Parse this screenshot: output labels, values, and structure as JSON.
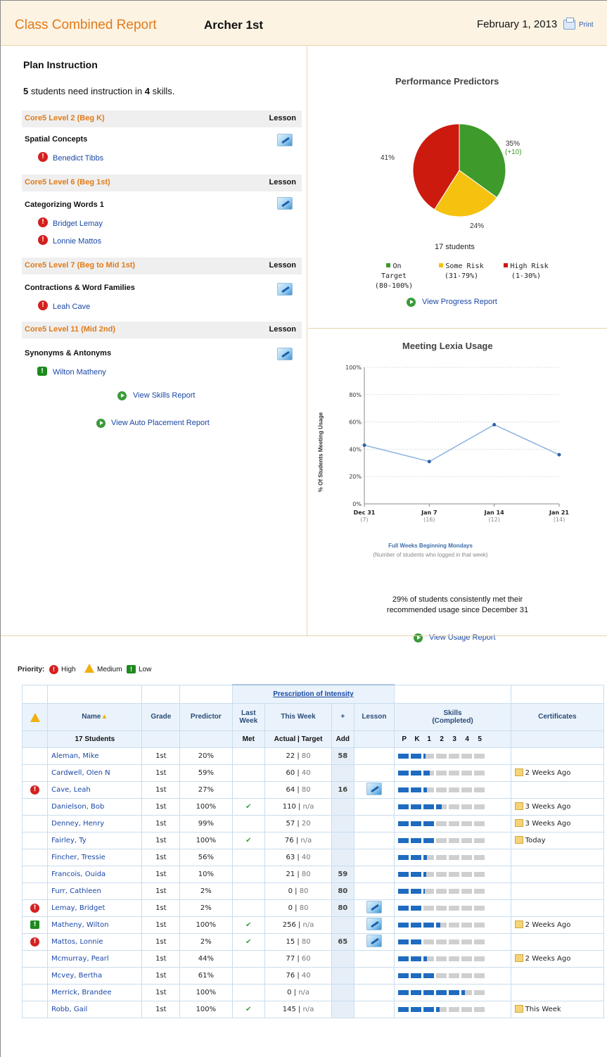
{
  "header": {
    "title": "Class Combined Report",
    "class_name": "Archer 1st",
    "date": "February 1, 2013",
    "print_label": "Print"
  },
  "plan": {
    "title": "Plan Instruction",
    "students_count": "5",
    "text_mid": "students need instruction in",
    "skills_count": "4",
    "text_end": "skills.",
    "lesson_label": "Lesson",
    "levels": [
      {
        "level": "Core5 Level 2 (Beg K)",
        "skill": "Spatial Concepts",
        "students": [
          {
            "name": "Benedict Tibbs",
            "priority": "high"
          }
        ]
      },
      {
        "level": "Core5 Level 6 (Beg 1st)",
        "skill": "Categorizing Words 1",
        "students": [
          {
            "name": "Bridget Lemay",
            "priority": "high"
          },
          {
            "name": "Lonnie Mattos",
            "priority": "high"
          }
        ]
      },
      {
        "level": "Core5 Level 7 (Beg to Mid 1st)",
        "skill": "Contractions & Word Families",
        "students": [
          {
            "name": "Leah Cave",
            "priority": "high"
          }
        ]
      },
      {
        "level": "Core5 Level 11 (Mid 2nd)",
        "skill": "Synonyms & Antonyms",
        "students": [
          {
            "name": "Wilton Matheny",
            "priority": "low"
          }
        ]
      }
    ],
    "links": {
      "skills": "View Skills Report",
      "placement": "View Auto Placement Report"
    }
  },
  "predictors": {
    "title": "Performance Predictors",
    "students_label": "17 students",
    "link": "View Progress Report",
    "slice_labels": {
      "on_target": "35%",
      "on_target_change": "(+10)",
      "some_risk": "24%",
      "high_risk": "41%"
    },
    "legend": [
      {
        "name": "On Target",
        "range": "(80-100%)",
        "color": "#3f9a2c"
      },
      {
        "name": "Some Risk",
        "range": "(31-79%)",
        "color": "#f5c20f"
      },
      {
        "name": "High Risk",
        "range": "(1-30%)",
        "color": "#cc1a0f"
      }
    ]
  },
  "usage": {
    "title": "Meeting Lexia Usage",
    "ylabel": "% Of Students Meeting Usage",
    "xlabel": "Full Weeks Beginning Mondays",
    "xsub": "(Number of students who logged in that week)",
    "summary_line1": "29% of students consistently met their",
    "summary_line2": "recommended usage since December 31",
    "link": "View Usage Report"
  },
  "chart_data": [
    {
      "type": "pie",
      "title": "Performance Predictors",
      "categories": [
        "On Target",
        "Some Risk",
        "High Risk"
      ],
      "values": [
        35,
        24,
        41
      ],
      "colors": [
        "#3f9a2c",
        "#f5c20f",
        "#cc1a0f"
      ]
    },
    {
      "type": "line",
      "title": "Meeting Lexia Usage",
      "xlabel": "Full Weeks Beginning Mondays",
      "ylabel": "% Of Students Meeting Usage",
      "categories": [
        "Dec 31",
        "Jan 7",
        "Jan 14",
        "Jan 21"
      ],
      "category_counts": [
        "(7)",
        "(16)",
        "(12)",
        "(14)"
      ],
      "values": [
        43,
        31,
        58,
        36
      ],
      "ylim": [
        0,
        100
      ],
      "yticks": [
        "0%",
        "20%",
        "40%",
        "60%",
        "80%",
        "100%"
      ],
      "grid": true
    }
  ],
  "priority_legend": {
    "label": "Priority:",
    "high": "High",
    "medium": "Medium",
    "low": "Low"
  },
  "table": {
    "group_header": "Prescription of Intensity",
    "headers": {
      "name": "Name",
      "grade": "Grade",
      "predictor": "Predictor",
      "last_week": "Last Week",
      "this_week": "This Week",
      "plus": "+",
      "lesson": "Lesson",
      "skills": "Skills",
      "skills_sub": "(Completed)",
      "certificates": "Certificates"
    },
    "subheaders": {
      "students": "17 Students",
      "met": "Met",
      "actual_target": "Actual | Target",
      "add": "Add",
      "levels": [
        "P",
        "K",
        "1",
        "2",
        "3",
        "4",
        "5"
      ]
    },
    "rows": [
      {
        "priority": "",
        "name": "Aleman, Mike",
        "grade": "1st",
        "predictor": "20%",
        "met": false,
        "actual": "22",
        "target": "80",
        "add": "58",
        "lesson": false,
        "skills": [
          1,
          1,
          0.15,
          0,
          0,
          0,
          0
        ],
        "cert": ""
      },
      {
        "priority": "",
        "name": "Cardwell, Olen N",
        "grade": "1st",
        "predictor": "59%",
        "met": false,
        "actual": "60",
        "target": "40",
        "add": "",
        "lesson": false,
        "skills": [
          1,
          1,
          0.6,
          0,
          0,
          0,
          0
        ],
        "cert": "2 Weeks Ago"
      },
      {
        "priority": "high",
        "name": "Cave, Leah",
        "grade": "1st",
        "predictor": "27%",
        "met": false,
        "actual": "64",
        "target": "80",
        "add": "16",
        "lesson": true,
        "skills": [
          1,
          1,
          0.3,
          0,
          0,
          0,
          0
        ],
        "cert": ""
      },
      {
        "priority": "",
        "name": "Danielson, Bob",
        "grade": "1st",
        "predictor": "100%",
        "met": true,
        "actual": "110",
        "target": "n/a",
        "add": "",
        "lesson": false,
        "skills": [
          1,
          1,
          1,
          0.5,
          0,
          0,
          0
        ],
        "cert": "3 Weeks Ago"
      },
      {
        "priority": "",
        "name": "Denney, Henry",
        "grade": "1st",
        "predictor": "99%",
        "met": false,
        "actual": "57",
        "target": "20",
        "add": "",
        "lesson": false,
        "skills": [
          1,
          1,
          1,
          0,
          0,
          0,
          0
        ],
        "cert": "3 Weeks Ago"
      },
      {
        "priority": "",
        "name": "Fairley, Ty",
        "grade": "1st",
        "predictor": "100%",
        "met": true,
        "actual": "76",
        "target": "n/a",
        "add": "",
        "lesson": false,
        "skills": [
          1,
          1,
          1,
          0,
          0,
          0,
          0
        ],
        "cert": "Today"
      },
      {
        "priority": "",
        "name": "Fincher, Tressie",
        "grade": "1st",
        "predictor": "56%",
        "met": false,
        "actual": "63",
        "target": "40",
        "add": "",
        "lesson": false,
        "skills": [
          1,
          1,
          0.3,
          0,
          0,
          0,
          0
        ],
        "cert": ""
      },
      {
        "priority": "",
        "name": "Francois, Ouida",
        "grade": "1st",
        "predictor": "10%",
        "met": false,
        "actual": "21",
        "target": "80",
        "add": "59",
        "lesson": false,
        "skills": [
          1,
          1,
          0.25,
          0,
          0,
          0,
          0
        ],
        "cert": ""
      },
      {
        "priority": "",
        "name": "Furr, Cathleen",
        "grade": "1st",
        "predictor": "2%",
        "met": false,
        "actual": "0",
        "target": "80",
        "add": "80",
        "lesson": false,
        "skills": [
          1,
          1,
          0.1,
          0,
          0,
          0,
          0
        ],
        "cert": ""
      },
      {
        "priority": "high",
        "name": "Lemay, Bridget",
        "grade": "1st",
        "predictor": "2%",
        "met": false,
        "actual": "0",
        "target": "80",
        "add": "80",
        "lesson": true,
        "skills": [
          1,
          1,
          0,
          0,
          0,
          0,
          0
        ],
        "cert": ""
      },
      {
        "priority": "low",
        "name": "Matheny, Wilton",
        "grade": "1st",
        "predictor": "100%",
        "met": true,
        "actual": "256",
        "target": "n/a",
        "add": "",
        "lesson": true,
        "skills": [
          1,
          1,
          1,
          0.4,
          0,
          0,
          0
        ],
        "cert": "2 Weeks Ago"
      },
      {
        "priority": "high",
        "name": "Mattos, Lonnie",
        "grade": "1st",
        "predictor": "2%",
        "met": true,
        "actual": "15",
        "target": "80",
        "add": "65",
        "lesson": true,
        "skills": [
          1,
          1,
          0,
          0,
          0,
          0,
          0
        ],
        "cert": ""
      },
      {
        "priority": "",
        "name": "Mcmurray, Pearl",
        "grade": "1st",
        "predictor": "44%",
        "met": false,
        "actual": "77",
        "target": "60",
        "add": "",
        "lesson": false,
        "skills": [
          1,
          1,
          0.3,
          0,
          0,
          0,
          0
        ],
        "cert": "2 Weeks Ago"
      },
      {
        "priority": "",
        "name": "Mcvey, Bertha",
        "grade": "1st",
        "predictor": "61%",
        "met": false,
        "actual": "76",
        "target": "40",
        "add": "",
        "lesson": false,
        "skills": [
          1,
          1,
          1,
          0,
          0,
          0,
          0
        ],
        "cert": ""
      },
      {
        "priority": "",
        "name": "Merrick, Brandee",
        "grade": "1st",
        "predictor": "100%",
        "met": false,
        "actual": "0",
        "target": "n/a",
        "add": "",
        "lesson": false,
        "skills": [
          1,
          1,
          1,
          1,
          1,
          0.3,
          0
        ],
        "cert": ""
      },
      {
        "priority": "",
        "name": "Robb, Gail",
        "grade": "1st",
        "predictor": "100%",
        "met": true,
        "actual": "145",
        "target": "n/a",
        "add": "",
        "lesson": false,
        "skills": [
          1,
          1,
          1,
          0.3,
          0,
          0,
          0
        ],
        "cert": "This Week"
      }
    ]
  }
}
